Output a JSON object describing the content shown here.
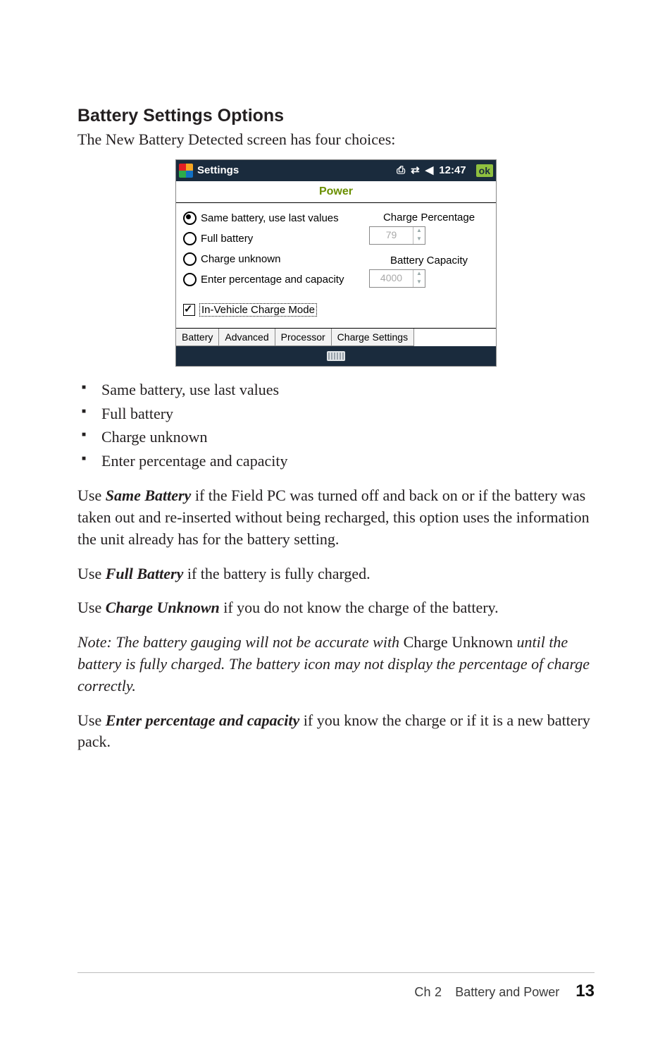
{
  "heading": "Battery Settings Options",
  "intro": "The New Battery Detected screen has four choices:",
  "screenshot": {
    "app_title": "Settings",
    "clock": "12:47",
    "ok_label": "ok",
    "panel_title": "Power",
    "radios": {
      "same_battery": "Same battery, use last values",
      "full_battery": "Full battery",
      "charge_unknown": "Charge unknown",
      "enter_pct_cap": "Enter percentage and capacity"
    },
    "labels": {
      "charge_pct": "Charge Percentage",
      "battery_cap": "Battery Capacity"
    },
    "values": {
      "charge_pct": "79",
      "battery_cap": "4000"
    },
    "checkbox_label": "In-Vehicle Charge Mode",
    "tabs": {
      "battery": "Battery",
      "advanced": "Advanced",
      "processor": "Processor",
      "charge_settings": "Charge Settings"
    }
  },
  "bullets": [
    "Same battery, use last values",
    "Full battery",
    "Charge unknown",
    "Enter percentage and capacity"
  ],
  "paragraphs": {
    "same_prefix": "Use ",
    "same_strong": "Same Battery",
    "same_rest": " if the Field PC was turned off and back on or if the battery was taken out and re-inserted without being recharged, this option uses the information the unit already has for the battery setting.",
    "full_prefix": "Use ",
    "full_strong": "Full Battery",
    "full_rest": " if the battery is fully charged.",
    "unk_prefix": "Use ",
    "unk_strong": "Charge Unknown",
    "unk_rest": " if you do not know the charge of the battery.",
    "note_prefix": "Note: The battery gauging will not be accurate with ",
    "note_nonitalic": "Charge Unknown",
    "note_rest": " until the battery is fully charged. The battery icon may not display the percentage of charge correctly.",
    "enter_prefix": "Use ",
    "enter_strong": "Enter percentage and capacity",
    "enter_rest": " if you know the charge or if it is a new battery pack."
  },
  "footer": {
    "chapter_label": "Ch 2",
    "chapter_title": "Battery and Power",
    "page_number": "13"
  }
}
